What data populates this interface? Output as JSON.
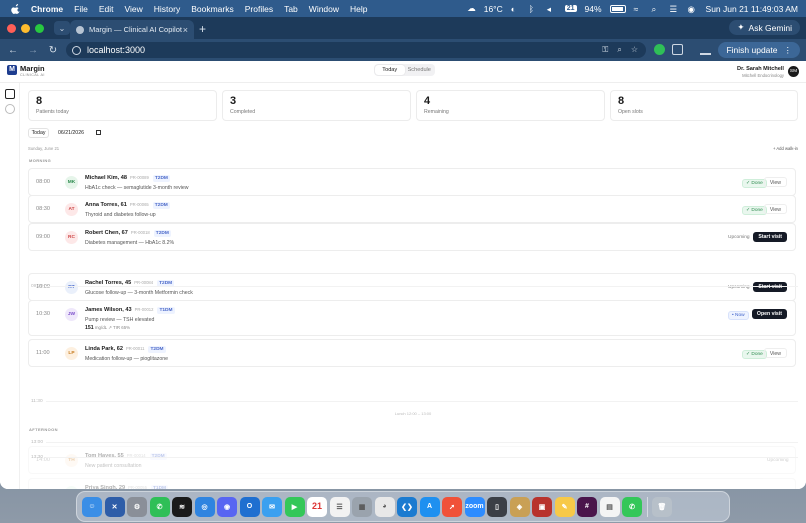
{
  "menubar": {
    "app": "Chrome",
    "items": [
      "File",
      "Edit",
      "View",
      "History",
      "Bookmarks",
      "Profiles",
      "Tab",
      "Window",
      "Help"
    ],
    "weather": "16°C",
    "calendar_badge": "21",
    "battery": "94%",
    "clock": "Sun Jun 21  11:49:03 AM"
  },
  "browser": {
    "tab_title": "Margin — Clinical AI Copilot",
    "url": "localhost:3000",
    "gemini_label": "Ask Gemini",
    "update_label": "Finish update"
  },
  "app": {
    "brand": "Margin",
    "brand_sub": "CLINICAL AI",
    "views": [
      "Today",
      "Schedule"
    ],
    "active_view": "Today",
    "doctor_name": "Dr. Sarah Mitchell",
    "doctor_role": "Mitchell Endocrinology",
    "doctor_initials": "SM"
  },
  "stats": [
    {
      "value": "8",
      "label": "Patients today",
      "color": "#1a1a1a"
    },
    {
      "value": "3",
      "label": "Completed",
      "color": "#2d8a4e"
    },
    {
      "value": "4",
      "label": "Remaining",
      "color": "#3b5fc9"
    },
    {
      "value": "8",
      "label": "Open slots",
      "color": "#1a1a1a"
    }
  ],
  "controls": {
    "today_label": "Today",
    "date_value": "06/21/2026",
    "day_label": "Sunday, June 21",
    "add_walk_in": "+ Add walk-in"
  },
  "sections": {
    "morning": "MORNING",
    "afternoon": "AFTERNOON",
    "lunch": "Lunch 12:00 – 13:00"
  },
  "gap_times": {
    "g1": "09:30",
    "g2": "11:30",
    "g3": "13:00",
    "g4": "13:30"
  },
  "appointments": [
    {
      "time": "08:00",
      "initials": "MK",
      "name": "Michael Kim, 48",
      "mrn": "PR-00089",
      "tag": "T2DM",
      "reason": "HbA1c check — semaglutide 3-month review",
      "status": "✓ Done",
      "action": "View",
      "av_bg": "#e6f5ea",
      "av_fg": "#2d8a4e"
    },
    {
      "time": "08:30",
      "initials": "AT",
      "name": "Anna Torres, 61",
      "mrn": "PR-00065",
      "tag": "T2DM",
      "reason": "Thyroid and diabetes follow-up",
      "status": "✓ Done",
      "action": "View",
      "av_bg": "#fde8e8",
      "av_fg": "#c44"
    },
    {
      "time": "09:00",
      "initials": "RC",
      "name": "Robert Chen, 67",
      "mrn": "PR-00018",
      "tag": "T2DM",
      "reason": "Diabetes management — HbA1c 8.2%",
      "status": "Upcoming",
      "action": "Start visit",
      "av_bg": "#fde8e8",
      "av_fg": "#c44"
    },
    {
      "time": "10:00",
      "initials": "RT",
      "name": "Rachel Torres, 45",
      "mrn": "PR-00084",
      "tag": "T2DM",
      "reason": "Glucose follow-up — 3-month Metformin check",
      "status": "Upcoming",
      "action": "Start visit",
      "av_bg": "#eaf0fb",
      "av_fg": "#3b5fc9"
    },
    {
      "time": "10:30",
      "initials": "JW",
      "name": "James Wilson, 43",
      "mrn": "PR-00012",
      "tag": "T1DM",
      "reason": "Pump review — TSH elevated",
      "metric_value": "151",
      "metric_text": "mg/dL  ↗  TIR 65%",
      "status": "• Now",
      "action": "Open visit",
      "av_bg": "#efe8fb",
      "av_fg": "#7a4cc9"
    },
    {
      "time": "11:00",
      "initials": "LP",
      "name": "Linda Park, 62",
      "mrn": "PR-00011",
      "tag": "T2DM",
      "reason": "Medication follow-up — pioglitazone",
      "status": "✓ Done",
      "action": "View",
      "av_bg": "#fdf0e0",
      "av_fg": "#c77a1e"
    },
    {
      "time": "14:00",
      "initials": "TH",
      "name": "Tom Hayes, 55",
      "mrn": "PR-00014",
      "tag": "T2DM",
      "reason": "New patient consultation",
      "status": "Upcoming",
      "action": "",
      "av_bg": "#fdf0e0",
      "av_fg": "#c77a1e"
    },
    {
      "time": "",
      "initials": "",
      "name": "Priya Singh, 29",
      "mrn": "PR-00055",
      "tag": "T1DM",
      "reason": "",
      "status": "",
      "action": "",
      "av_bg": "#e6f5ea",
      "av_fg": "#2d8a4e"
    }
  ],
  "dock": [
    {
      "name": "finder-icon",
      "color": "#3a8ee6",
      "glyph": "☺"
    },
    {
      "name": "xcode-icon",
      "color": "#2e5da8",
      "glyph": "✕"
    },
    {
      "name": "system-settings-icon",
      "color": "#8a8f98",
      "glyph": "⚙"
    },
    {
      "name": "whatsapp-icon",
      "color": "#2fbf57",
      "glyph": "✆"
    },
    {
      "name": "spotify-icon",
      "color": "#1a1a1a",
      "glyph": "≋"
    },
    {
      "name": "safari-icon",
      "color": "#2f84e0",
      "glyph": "◎"
    },
    {
      "name": "discord-icon",
      "color": "#5865f2",
      "glyph": "◉"
    },
    {
      "name": "outlook-icon",
      "color": "#1f6fd0",
      "glyph": "O"
    },
    {
      "name": "mail-icon",
      "color": "#3aa0f0",
      "glyph": "✉"
    },
    {
      "name": "facetime-icon",
      "color": "#34c759",
      "glyph": "▶"
    },
    {
      "name": "calendar-icon",
      "color": "#ffffff",
      "glyph": "21"
    },
    {
      "name": "reminders-icon",
      "color": "#f2f2f2",
      "glyph": "☰"
    },
    {
      "name": "launchpad-icon",
      "color": "#9aa3ad",
      "glyph": "▦"
    },
    {
      "name": "chrome-icon",
      "color": "#e8e8e8",
      "glyph": "◕"
    },
    {
      "name": "vscode-icon",
      "color": "#1b7bd0",
      "glyph": "❮❯"
    },
    {
      "name": "app-store-icon",
      "color": "#1e90f0",
      "glyph": "A"
    },
    {
      "name": "swift-icon",
      "color": "#f05138",
      "glyph": "➚"
    },
    {
      "name": "zoom-icon",
      "color": "#2d8cff",
      "glyph": "zoom"
    },
    {
      "name": "simulator-icon",
      "color": "#3b3f46",
      "glyph": "▯"
    },
    {
      "name": "preview-icon",
      "color": "#c9a055",
      "glyph": "◈"
    },
    {
      "name": "photo-booth-icon",
      "color": "#b8332d",
      "glyph": "▣"
    },
    {
      "name": "notes-icon",
      "color": "#f7c948",
      "glyph": "✎"
    },
    {
      "name": "slack-icon",
      "color": "#4a154b",
      "glyph": "#"
    },
    {
      "name": "activity-icon",
      "color": "#f4f4f4",
      "glyph": "▤"
    },
    {
      "name": "phone-icon",
      "color": "#34c759",
      "glyph": "✆"
    },
    {
      "name": "trash-icon",
      "color": "#b7c0c9",
      "glyph": "🗑"
    }
  ]
}
